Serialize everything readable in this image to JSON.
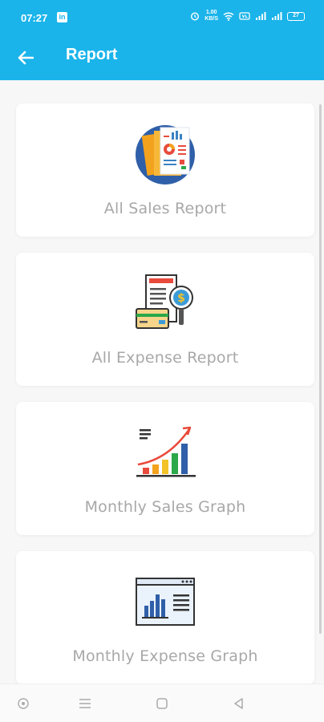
{
  "status_bar": {
    "time": "07:27",
    "linkedin_glyph": "in",
    "net_speed_value": "1.00",
    "net_speed_unit": "KB/S",
    "battery_level": "27",
    "icons": [
      "alarm-icon",
      "wifi-icon",
      "volte-icon",
      "signal-icon",
      "signal-icon",
      "battery-icon"
    ]
  },
  "app_bar": {
    "title": "Report",
    "back_icon": "arrow-left-icon"
  },
  "cards": [
    {
      "label": "All Sales Report",
      "icon": "sales-report-icon"
    },
    {
      "label": "All Expense Report",
      "icon": "expense-report-icon"
    },
    {
      "label": "Monthly Sales Graph",
      "icon": "sales-graph-icon"
    },
    {
      "label": "Monthly Expense Graph",
      "icon": "expense-graph-icon"
    }
  ],
  "nav_bar": {
    "icons": [
      "assistant-icon",
      "menu-icon",
      "home-square-icon",
      "back-triangle-icon"
    ]
  },
  "colors": {
    "header": "#1ab4ea",
    "card_label": "#a8a8a8",
    "background": "#f7f7f7"
  }
}
